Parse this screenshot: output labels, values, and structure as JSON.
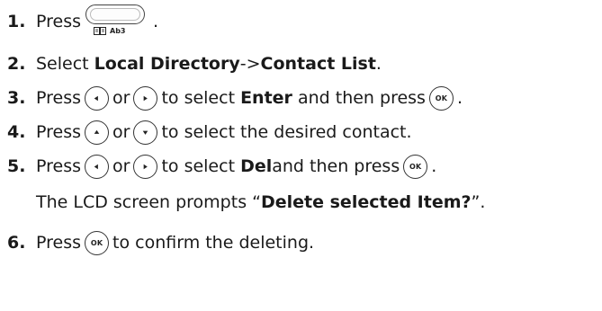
{
  "steps": [
    {
      "num": "1.",
      "parts": {
        "a": "Press",
        "b": "."
      },
      "key_label": "Ab3"
    },
    {
      "num": "2.",
      "parts": {
        "a": "Select ",
        "b": "Local Directory",
        "c": "->",
        "d": "Contact List",
        "e": "."
      }
    },
    {
      "num": "3.",
      "parts": {
        "a": "Press",
        "b": "or",
        "c": "to select ",
        "d": "Enter",
        "e": " and then press",
        "f": "."
      },
      "ok": "OK"
    },
    {
      "num": "4.",
      "parts": {
        "a": "Press",
        "b": "or",
        "c": "to select the desired contact."
      }
    },
    {
      "num": "5.",
      "parts": {
        "a": "Press",
        "b": "or",
        "c": "to select ",
        "d": "Del",
        "e": "and then press",
        "f": "."
      },
      "ok": "OK"
    },
    {
      "note": {
        "a": "The LCD screen prompts “",
        "b": "Delete selected Item?",
        "c": "”."
      }
    },
    {
      "num": "6.",
      "parts": {
        "a": "Press",
        "b": "to confirm the deleting."
      },
      "ok": "OK"
    }
  ],
  "icons": {
    "directory_key": "directory-softkey-icon",
    "left": "left-arrow-key-icon",
    "right": "right-arrow-key-icon",
    "up": "up-arrow-key-icon",
    "down": "down-arrow-key-icon",
    "ok": "ok-key-icon",
    "book": "book-icon"
  }
}
